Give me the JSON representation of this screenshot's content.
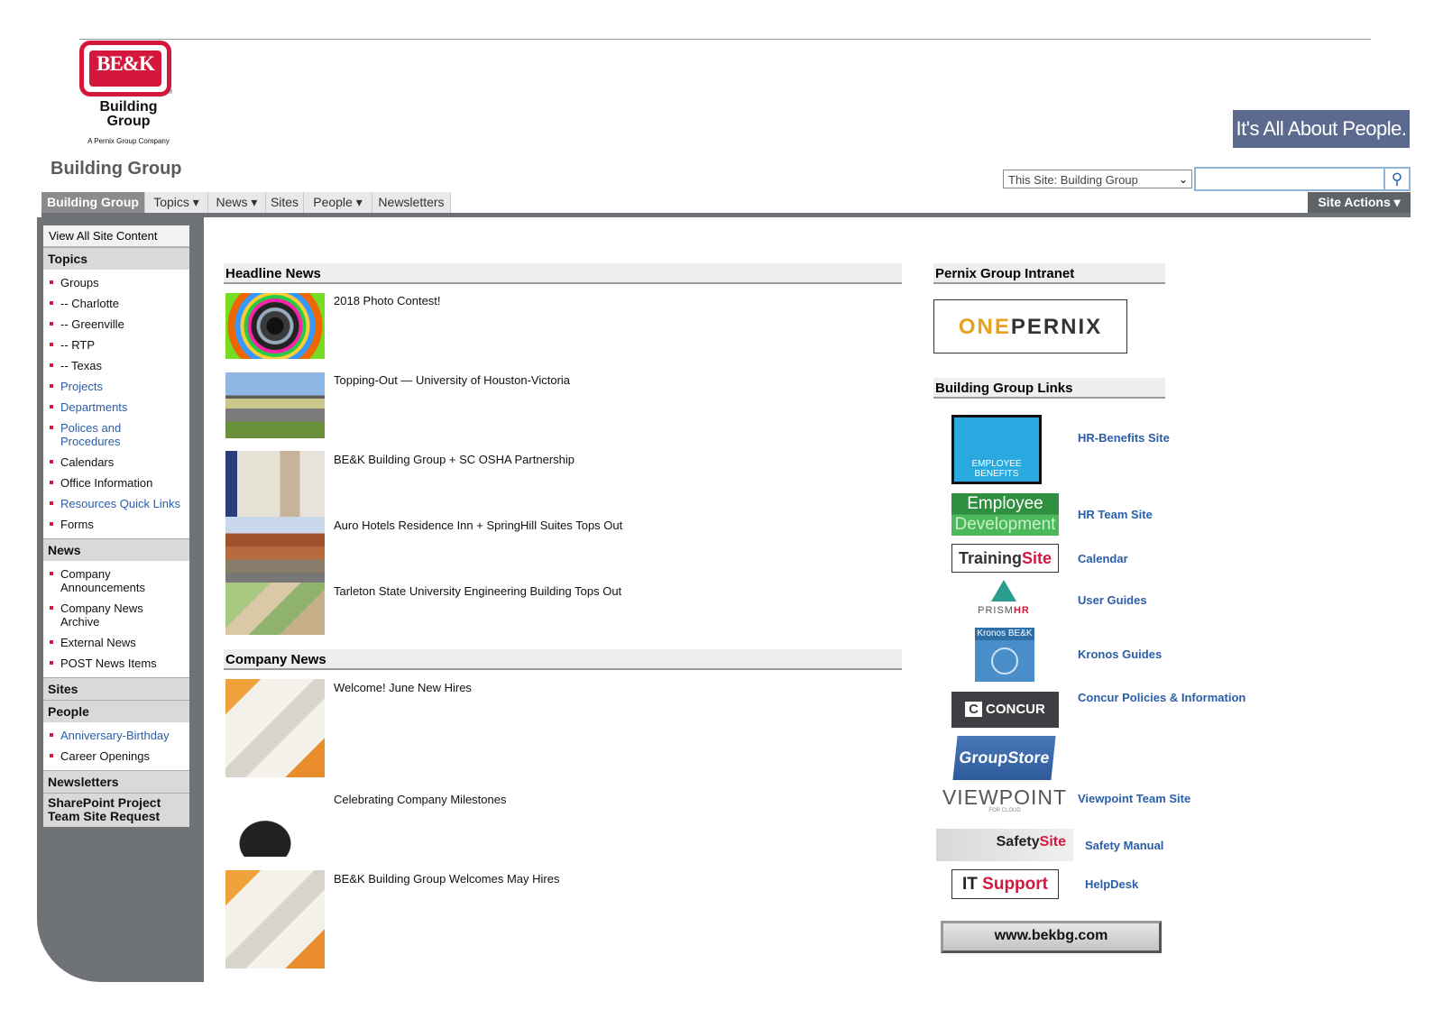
{
  "header": {
    "logo_badge": "BE&K",
    "logo_reg": "®",
    "logo_name_line1": "Building",
    "logo_name_line2": "Group",
    "logo_sub": "A Pernix Group Company",
    "site_title": "Building Group",
    "slogan": "It's All About People."
  },
  "search": {
    "scope": "This Site: Building Group",
    "placeholder": "",
    "button_icon": "search-icon"
  },
  "nav": {
    "items": [
      {
        "label": "Building Group",
        "active": true
      },
      {
        "label": "Topics ▾"
      },
      {
        "label": "News ▾"
      },
      {
        "label": "Sites"
      },
      {
        "label": "People ▾"
      },
      {
        "label": "Newsletters"
      }
    ],
    "site_actions": "Site Actions ▾"
  },
  "leftnav": {
    "view_all": "View All Site Content",
    "topics": {
      "heading": "Topics",
      "items": [
        "Groups",
        "-- Charlotte",
        "-- Greenville",
        "-- RTP",
        "-- Texas",
        "Projects",
        "Departments",
        "Polices and Procedures",
        "Calendars",
        "Office Information",
        "Resources Quick Links",
        "Forms"
      ]
    },
    "news": {
      "heading": "News",
      "items": [
        "Company Announcements",
        "Company News Archive",
        "External News",
        "POST News Items"
      ]
    },
    "sites": {
      "heading": "Sites"
    },
    "people": {
      "heading": "People",
      "items": [
        "Anniversary-Birthday",
        "Career Openings"
      ]
    },
    "newsletters": {
      "heading": "Newsletters"
    },
    "sharepoint": {
      "heading": "SharePoint Project Team Site Request"
    }
  },
  "headline_news": {
    "heading": "Headline News",
    "items": [
      "2018 Photo Contest!",
      "Topping-Out — University of Houston-Victoria",
      "BE&K Building Group + SC OSHA Partnership",
      "Auro Hotels Residence Inn + SpringHill Suites Tops Out",
      "Tarleton State University Engineering Building Tops Out"
    ]
  },
  "company_news": {
    "heading": "Company News",
    "items": [
      "Welcome! June New Hires",
      "Celebrating Company Milestones",
      "BE&K Building Group Welcomes May Hires"
    ]
  },
  "intranet": {
    "heading": "Pernix Group Intranet",
    "logo_part1": "ONE",
    "logo_part2": "PERNIX"
  },
  "links": {
    "heading": "Building Group Links",
    "logos": {
      "benefits_1": "EMPLOYEE",
      "benefits_2": "BENEFITS",
      "dev_1": "Employee",
      "dev_2": "Development",
      "training_1": "Training",
      "training_2": "Site",
      "prism_1": "PRISM",
      "prism_2": "HR",
      "kronos": "Kronos BE&K",
      "concur": "CONCUR",
      "concur_mark": "C",
      "groupstore": "GroupStore",
      "viewpoint": "VIEWPOINT",
      "viewpoint_sub": "FOR CLOUD",
      "safety_1": "Safety",
      "safety_2": "Site",
      "it_1": "IT",
      "it_2": "Support"
    },
    "items": [
      "HR-Benefits Site",
      "HR Team Site",
      "Calendar",
      "User Guides",
      "Kronos Guides",
      "Concur Policies & Information",
      "Viewpoint Team Site",
      "Safety Manual",
      "HelpDesk"
    ],
    "website": "www.bekbg.com"
  }
}
